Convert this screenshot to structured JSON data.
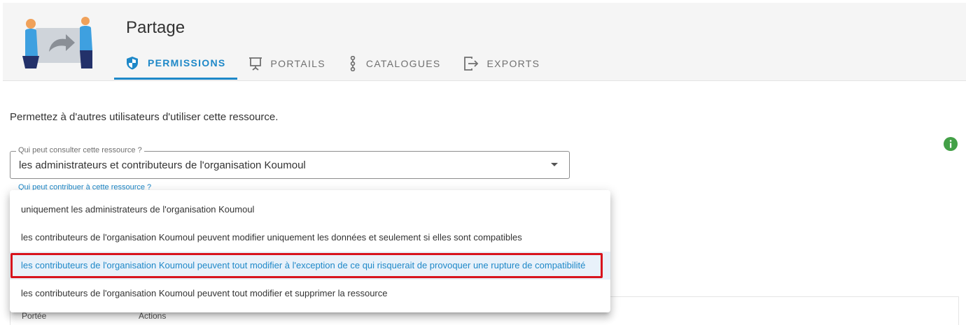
{
  "header": {
    "title": "Partage",
    "tabs": [
      {
        "label": "PERMISSIONS",
        "icon": "shield-icon",
        "active": true
      },
      {
        "label": "PORTAILS",
        "icon": "presentation-board-icon",
        "active": false
      },
      {
        "label": "CATALOGUES",
        "icon": "chain-link-icon",
        "active": false
      },
      {
        "label": "EXPORTS",
        "icon": "export-icon",
        "active": false
      }
    ]
  },
  "main": {
    "intro": "Permettez à d'autres utilisateurs d'utiliser cette ressource.",
    "consult_select": {
      "label": "Qui peut consulter cette ressource ?",
      "value": "les administrateurs et contributeurs de l'organisation Koumoul"
    },
    "contribute_label": "Qui peut contribuer à cette ressource ?",
    "dropdown_options": [
      {
        "label": "uniquement les administrateurs de l'organisation Koumoul",
        "selected": false
      },
      {
        "label": "les contributeurs de l'organisation Koumoul peuvent modifier uniquement les données et seulement si elles sont compatibles",
        "selected": false
      },
      {
        "label": "les contributeurs de l'organisation Koumoul peuvent tout modifier à l'exception de ce qui risquerait de provoquer une rupture de compatibilité",
        "selected": true
      },
      {
        "label": "les contributeurs de l'organisation Koumoul peuvent tout modifier et supprimer la ressource",
        "selected": false
      }
    ],
    "table_headers": [
      "Portée",
      "Actions"
    ]
  },
  "colors": {
    "accent": "#1e88c8",
    "highlight": "#d8141e",
    "info": "#43a047"
  }
}
